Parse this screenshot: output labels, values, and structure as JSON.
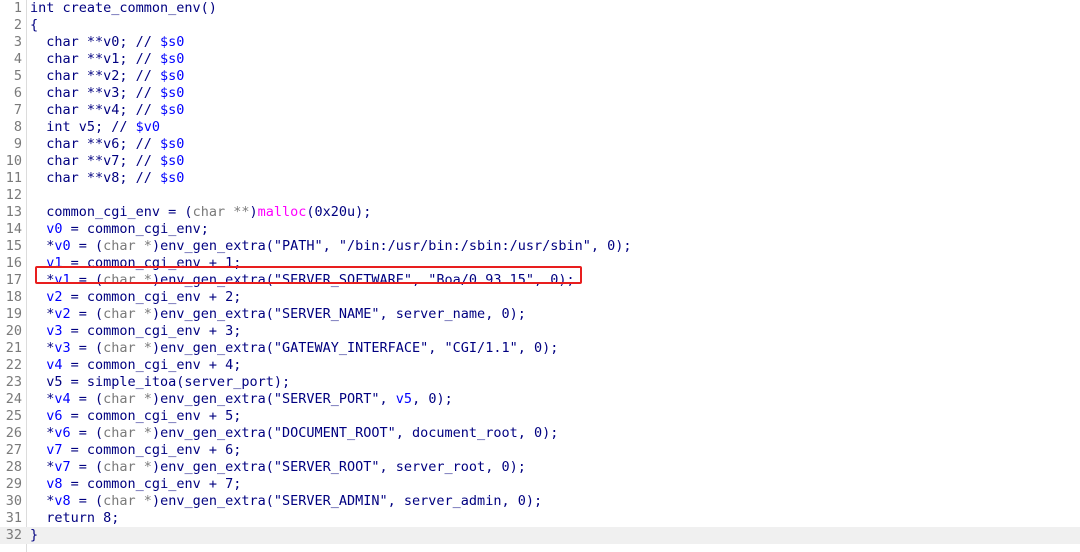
{
  "editor": {
    "accent_color": "#e81e1e",
    "current_line": 32,
    "highlighted_line": 17,
    "lines": [
      {
        "n": "1",
        "tokens": [
          {
            "t": "int create_common_env()",
            "c": "o"
          }
        ]
      },
      {
        "n": "2",
        "tokens": [
          {
            "t": "{",
            "c": "o"
          }
        ]
      },
      {
        "n": "3",
        "tokens": [
          {
            "t": "  char **v0; // ",
            "c": "o"
          },
          {
            "t": "$s0",
            "c": "c"
          }
        ]
      },
      {
        "n": "4",
        "tokens": [
          {
            "t": "  char **v1; // ",
            "c": "o"
          },
          {
            "t": "$s0",
            "c": "c"
          }
        ]
      },
      {
        "n": "5",
        "tokens": [
          {
            "t": "  char **v2; // ",
            "c": "o"
          },
          {
            "t": "$s0",
            "c": "c"
          }
        ]
      },
      {
        "n": "6",
        "tokens": [
          {
            "t": "  char **v3; // ",
            "c": "o"
          },
          {
            "t": "$s0",
            "c": "c"
          }
        ]
      },
      {
        "n": "7",
        "tokens": [
          {
            "t": "  char **v4; // ",
            "c": "o"
          },
          {
            "t": "$s0",
            "c": "c"
          }
        ]
      },
      {
        "n": "8",
        "tokens": [
          {
            "t": "  int v5; // ",
            "c": "o"
          },
          {
            "t": "$v0",
            "c": "c"
          }
        ]
      },
      {
        "n": "9",
        "tokens": [
          {
            "t": "  char **v6; // ",
            "c": "o"
          },
          {
            "t": "$s0",
            "c": "c"
          }
        ]
      },
      {
        "n": "10",
        "tokens": [
          {
            "t": "  char **v7; // ",
            "c": "o"
          },
          {
            "t": "$s0",
            "c": "c"
          }
        ]
      },
      {
        "n": "11",
        "tokens": [
          {
            "t": "  char **v8; // ",
            "c": "o"
          },
          {
            "t": "$s0",
            "c": "c"
          }
        ]
      },
      {
        "n": "12",
        "tokens": []
      },
      {
        "n": "13",
        "tokens": [
          {
            "t": "  common_cgi_env = (",
            "c": "o"
          },
          {
            "t": "char **",
            "c": "p"
          },
          {
            "t": ")",
            "c": "o"
          },
          {
            "t": "malloc",
            "c": "f"
          },
          {
            "t": "(0x20u);",
            "c": "o"
          }
        ]
      },
      {
        "n": "14",
        "tokens": [
          {
            "t": "  ",
            "c": "o"
          },
          {
            "t": "v0",
            "c": "l"
          },
          {
            "t": " = common_cgi_env;",
            "c": "o"
          }
        ]
      },
      {
        "n": "15",
        "tokens": [
          {
            "t": "  *",
            "c": "o"
          },
          {
            "t": "v0",
            "c": "l"
          },
          {
            "t": " = (",
            "c": "o"
          },
          {
            "t": "char *",
            "c": "p"
          },
          {
            "t": ")env_gen_extra(\"PATH\", \"/bin:/usr/bin:/sbin:/usr/sbin\", 0);",
            "c": "o"
          }
        ]
      },
      {
        "n": "16",
        "tokens": [
          {
            "t": "  ",
            "c": "o"
          },
          {
            "t": "v1",
            "c": "l"
          },
          {
            "t": " = common_cgi_env + 1;",
            "c": "o"
          }
        ]
      },
      {
        "n": "17",
        "tokens": [
          {
            "t": "  *",
            "c": "o"
          },
          {
            "t": "v1",
            "c": "l"
          },
          {
            "t": " = (",
            "c": "o"
          },
          {
            "t": "char *",
            "c": "p"
          },
          {
            "t": ")env_gen_extra(\"SERVER_SOFTWARE\", \"Boa/0.93.15\", 0);",
            "c": "o"
          }
        ]
      },
      {
        "n": "18",
        "tokens": [
          {
            "t": "  ",
            "c": "o"
          },
          {
            "t": "v2",
            "c": "l"
          },
          {
            "t": " = common_cgi_env + 2;",
            "c": "o"
          }
        ]
      },
      {
        "n": "19",
        "tokens": [
          {
            "t": "  *",
            "c": "o"
          },
          {
            "t": "v2",
            "c": "l"
          },
          {
            "t": " = (",
            "c": "o"
          },
          {
            "t": "char *",
            "c": "p"
          },
          {
            "t": ")env_gen_extra(\"SERVER_NAME\", server_name, 0);",
            "c": "o"
          }
        ]
      },
      {
        "n": "20",
        "tokens": [
          {
            "t": "  ",
            "c": "o"
          },
          {
            "t": "v3",
            "c": "l"
          },
          {
            "t": " = common_cgi_env + 3;",
            "c": "o"
          }
        ]
      },
      {
        "n": "21",
        "tokens": [
          {
            "t": "  *",
            "c": "o"
          },
          {
            "t": "v3",
            "c": "l"
          },
          {
            "t": " = (",
            "c": "o"
          },
          {
            "t": "char *",
            "c": "p"
          },
          {
            "t": ")env_gen_extra(\"GATEWAY_INTERFACE\", \"CGI/1.1\", 0);",
            "c": "o"
          }
        ]
      },
      {
        "n": "22",
        "tokens": [
          {
            "t": "  ",
            "c": "o"
          },
          {
            "t": "v4",
            "c": "l"
          },
          {
            "t": " = common_cgi_env + 4;",
            "c": "o"
          }
        ]
      },
      {
        "n": "23",
        "tokens": [
          {
            "t": "  v5 = simple_itoa(server_port);",
            "c": "o"
          }
        ]
      },
      {
        "n": "24",
        "tokens": [
          {
            "t": "  *",
            "c": "o"
          },
          {
            "t": "v4",
            "c": "l"
          },
          {
            "t": " = (",
            "c": "o"
          },
          {
            "t": "char *",
            "c": "p"
          },
          {
            "t": ")env_gen_extra(\"SERVER_PORT\", ",
            "c": "o"
          },
          {
            "t": "v5",
            "c": "l"
          },
          {
            "t": ", 0);",
            "c": "o"
          }
        ]
      },
      {
        "n": "25",
        "tokens": [
          {
            "t": "  ",
            "c": "o"
          },
          {
            "t": "v6",
            "c": "l"
          },
          {
            "t": " = common_cgi_env + 5;",
            "c": "o"
          }
        ]
      },
      {
        "n": "26",
        "tokens": [
          {
            "t": "  *",
            "c": "o"
          },
          {
            "t": "v6",
            "c": "l"
          },
          {
            "t": " = (",
            "c": "o"
          },
          {
            "t": "char *",
            "c": "p"
          },
          {
            "t": ")env_gen_extra(\"DOCUMENT_ROOT\", document_root, 0);",
            "c": "o"
          }
        ]
      },
      {
        "n": "27",
        "tokens": [
          {
            "t": "  ",
            "c": "o"
          },
          {
            "t": "v7",
            "c": "l"
          },
          {
            "t": " = common_cgi_env + 6;",
            "c": "o"
          }
        ]
      },
      {
        "n": "28",
        "tokens": [
          {
            "t": "  *",
            "c": "o"
          },
          {
            "t": "v7",
            "c": "l"
          },
          {
            "t": " = (",
            "c": "o"
          },
          {
            "t": "char *",
            "c": "p"
          },
          {
            "t": ")env_gen_extra(\"SERVER_ROOT\", server_root, 0);",
            "c": "o"
          }
        ]
      },
      {
        "n": "29",
        "tokens": [
          {
            "t": "  ",
            "c": "o"
          },
          {
            "t": "v8",
            "c": "l"
          },
          {
            "t": " = common_cgi_env + 7;",
            "c": "o"
          }
        ]
      },
      {
        "n": "30",
        "tokens": [
          {
            "t": "  *",
            "c": "o"
          },
          {
            "t": "v8",
            "c": "l"
          },
          {
            "t": " = (",
            "c": "o"
          },
          {
            "t": "char *",
            "c": "p"
          },
          {
            "t": ")env_gen_extra(\"SERVER_ADMIN\", server_admin, 0);",
            "c": "o"
          }
        ]
      },
      {
        "n": "31",
        "tokens": [
          {
            "t": "  return 8;",
            "c": "o"
          }
        ]
      },
      {
        "n": "32",
        "tokens": [
          {
            "t": "}",
            "c": "o"
          }
        ]
      }
    ]
  }
}
